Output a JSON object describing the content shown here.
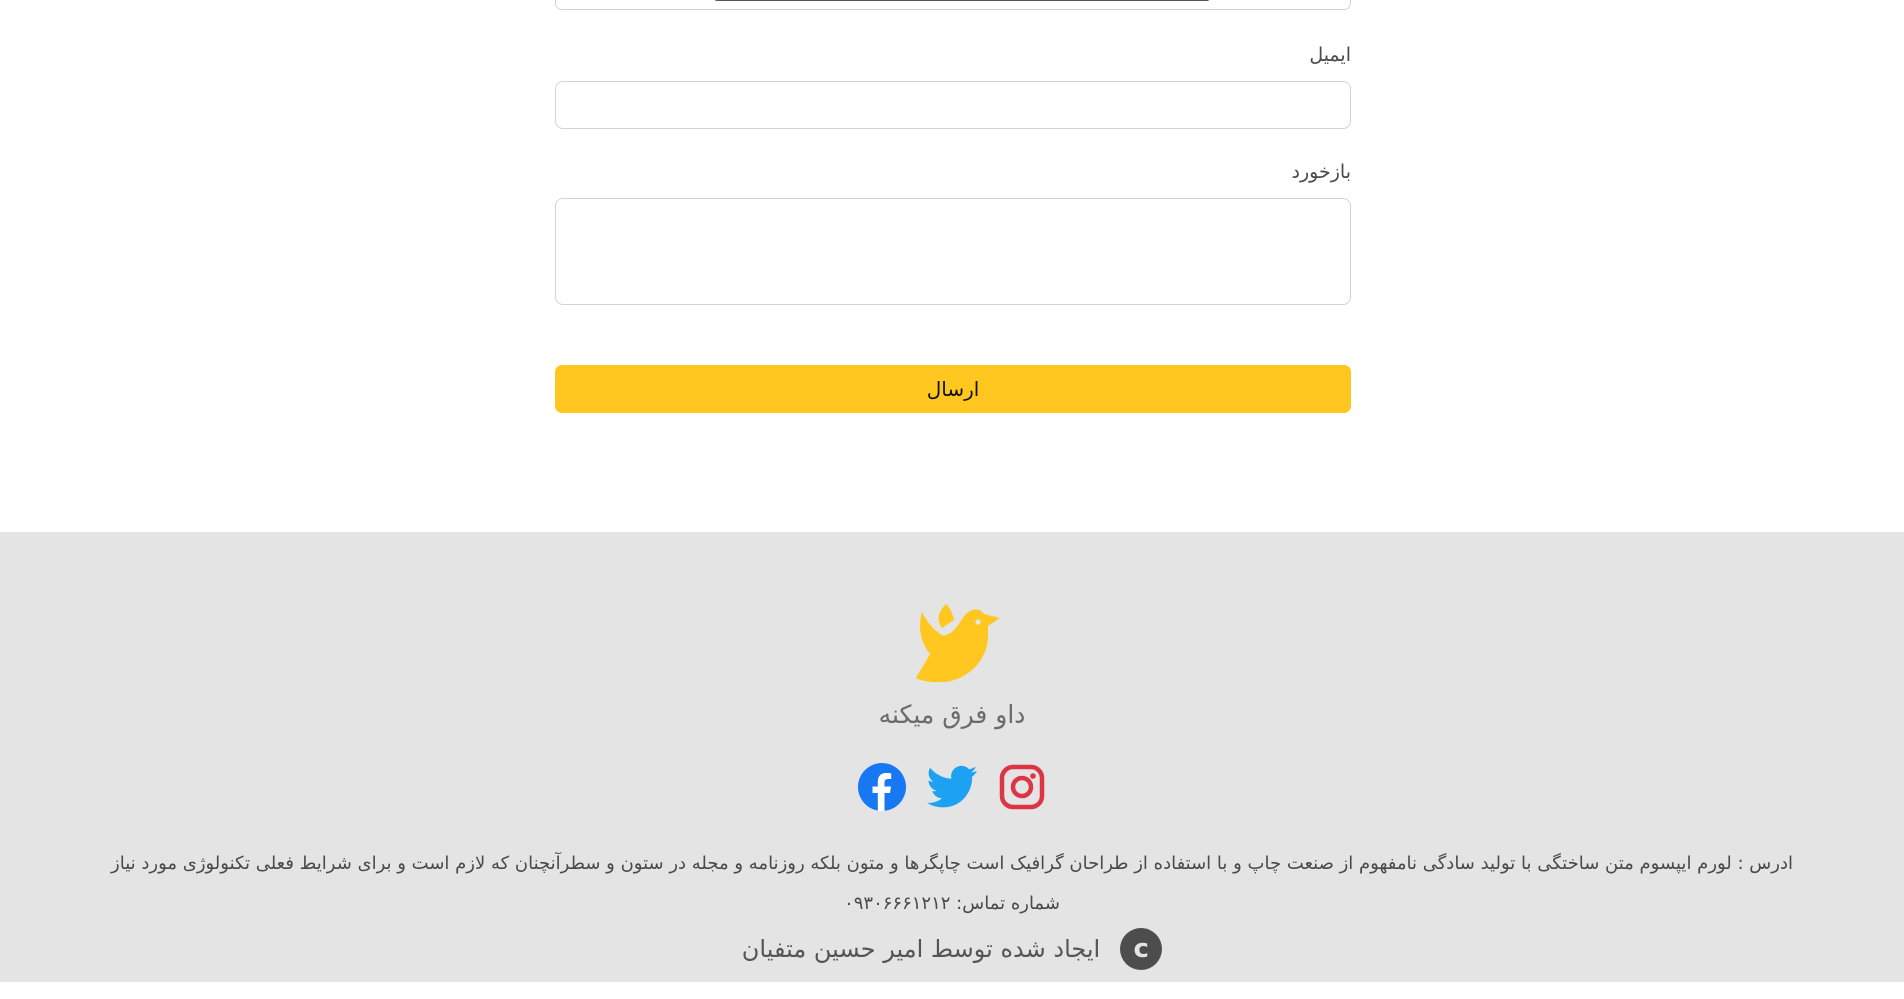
{
  "form": {
    "email_label": "ایمیل",
    "email_value": "",
    "feedback_label": "بازخورد",
    "feedback_value": "",
    "submit_label": "ارسال"
  },
  "footer": {
    "brand": "داو فرق میکنه",
    "logo_icon": "dove-icon",
    "accent_color": "#ffc720",
    "socials": [
      {
        "name": "facebook",
        "icon": "facebook-icon",
        "color": "#1877f2"
      },
      {
        "name": "twitter",
        "icon": "twitter-icon",
        "color": "#1da1f2"
      },
      {
        "name": "instagram",
        "icon": "instagram-icon",
        "color": "#e1306c"
      }
    ],
    "address_line": "ادرس : لورم ایپسوم متن ساختگی با تولید سادگی نامفهوم از صنعت چاپ و با استفاده از طراحان گرافیک است چاپگرها و متون بلکه روزنامه و مجله در ستون و سطرآنچنان که لازم است و برای شرایط فعلی تکنولوژی مورد نیاز",
    "phone_line": "شماره تماس: ۰۹۳۰۶۶۶۱۲۱۲",
    "credit": "ایجاد شده توسط امیر حسین متفیان",
    "copyright_symbol": "c"
  }
}
